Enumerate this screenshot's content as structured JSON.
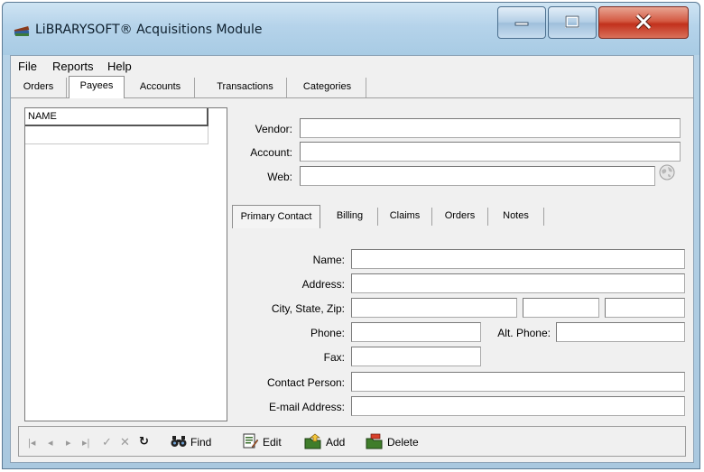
{
  "window": {
    "title": "LiBRARYSOFT® Acquisitions Module"
  },
  "menu": [
    "File",
    "Reports",
    "Help"
  ],
  "main_tabs": [
    "Orders",
    "Payees",
    "Accounts",
    "Transactions",
    "Categories"
  ],
  "active_main_tab": "Payees",
  "grid": {
    "header": "NAME"
  },
  "form": {
    "vendor_label": "Vendor:",
    "account_label": "Account:",
    "web_label": "Web:",
    "vendor_value": "",
    "account_value": "",
    "web_value": ""
  },
  "sub_tabs": [
    "Primary Contact",
    "Billing",
    "Claims",
    "Orders",
    "Notes"
  ],
  "active_sub_tab": "Primary Contact",
  "contact": {
    "name_label": "Name:",
    "address_label": "Address:",
    "city_label": "City, State, Zip:",
    "phone_label": "Phone:",
    "alt_phone_label": "Alt. Phone:",
    "fax_label": "Fax:",
    "contact_person_label": "Contact Person:",
    "email_label": "E-mail Address:"
  },
  "toolbar": {
    "find_label": "Find",
    "edit_label": "Edit",
    "add_label": "Add",
    "delete_label": "Delete"
  },
  "icons": {
    "app": "books-icon",
    "globe": "globe-icon",
    "find": "binoculars-icon",
    "edit": "edit-document-icon",
    "add": "add-folder-icon",
    "delete": "delete-folder-icon"
  },
  "colors": {
    "title_bar": "#b5d3ea",
    "close_button": "#c2311c",
    "panel_bg": "#f0f0f0"
  }
}
